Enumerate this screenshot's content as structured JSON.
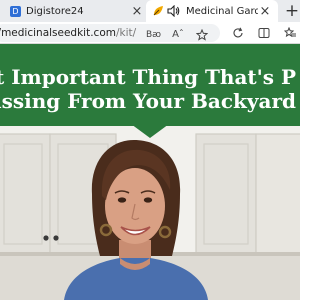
{
  "tabs": [
    {
      "title": "Digistore24",
      "favicon": "digistore-icon",
      "favicon_text": "D",
      "active": false
    },
    {
      "title": "Medicinal Garden Kit",
      "favicon": "leaf-icon",
      "audio": "speaker-icon",
      "active": true
    }
  ],
  "tab_close_glyph": "×",
  "new_tab_glyph": "+",
  "address": {
    "domain": "//medicinalseedkit.com",
    "path": "/kit/",
    "reader_label": "Bꜵ",
    "text_size_label": "Aˆ"
  },
  "banner": {
    "line1": "t Important Thing That's P",
    "line2": "issing From Your Backyard",
    "color": "#2b7a3c"
  }
}
